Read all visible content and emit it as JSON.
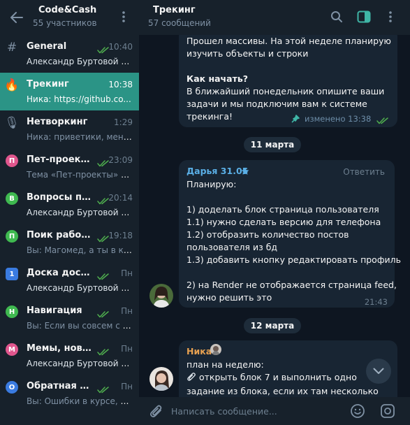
{
  "sidebar": {
    "title": "Code&Cash",
    "subtitle": "55 участников",
    "topics": [
      {
        "icon": "hash-icon",
        "icon_text": "#",
        "title": "General",
        "time": "10:40",
        "read": true,
        "sender": "Александр Буртовой о...",
        "preview": ""
      },
      {
        "icon": "fire-icon",
        "icon_text": "🔥",
        "title": "Трекинг",
        "time": "10:38",
        "read": false,
        "sender": "",
        "preview": "Ника: https://github.co...",
        "active": true
      },
      {
        "icon": "microphone-icon",
        "icon_text": "🎙",
        "title": "Нетворкинг",
        "time": "1:29",
        "read": false,
        "sender": "",
        "preview": "Ника: приветики, меня..."
      },
      {
        "icon": "letter-p-icon",
        "icon_text": "П",
        "color": "#e0568d",
        "title": "Пет-проекты",
        "time": "23:09",
        "read": true,
        "sender": "",
        "preview": "Тема «Пет-проекты» со..."
      },
      {
        "icon": "letter-v-icon",
        "icon_text": "В",
        "color": "#3fb950",
        "title": "Вопросы по ...",
        "time": "20:14",
        "read": true,
        "sender": "Александр Буртовой и...",
        "preview": ""
      },
      {
        "icon": "letter-p-icon",
        "icon_text": "П",
        "color": "#3fb950",
        "title": "Поик работ...",
        "time": "19:18",
        "read": true,
        "sender": "",
        "preview": "Вы: Магомед, а ты в ка..."
      },
      {
        "icon": "number-one-icon",
        "icon_text": "1",
        "color": "#3a7be0",
        "square": true,
        "title": "Доска достиже...",
        "time": "Пн",
        "read": true,
        "sender": "Александр Буртовой и...",
        "preview": ""
      },
      {
        "icon": "letter-n-icon",
        "icon_text": "Н",
        "color": "#3fb950",
        "title": "Навигация",
        "time": "Пн",
        "read": true,
        "sender": "",
        "preview": "Вы: Если вы совсем с 0 ..."
      },
      {
        "icon": "letter-m-icon",
        "icon_text": "М",
        "color": "#e0568d",
        "title": "Мемы, новост...",
        "time": "Пн",
        "read": true,
        "sender": "Александр Буртовой и...",
        "preview": ""
      },
      {
        "icon": "letter-o-icon",
        "icon_text": "О",
        "color": "#3a7be0",
        "title": "Обратная связ...",
        "time": "Пн",
        "read": true,
        "sender": "",
        "preview": "Вы: Ошибки в курсе, п..."
      }
    ]
  },
  "chat": {
    "title": "Трекинг",
    "subtitle": "57 сообщений",
    "messages": [
      {
        "lines": [
          "Прошел массивы. На этой неделе планирую",
          "изучить объекты и строки",
          "",
          "Как начать?",
          "В ближайший понедельник опишите ваши",
          "задачи и мы подключим вам к системе",
          "трекинга!"
        ],
        "bold_line": "Как начать?",
        "status": "изменено 13:38"
      },
      {
        "date": "11 марта"
      },
      {
        "author": "Дарья 31.05",
        "reply_label": "Ответить",
        "lines": [
          "Планирую:",
          "",
          "1) доделать блок страница пользователя",
          "1.1) нужно сделать версию для телефона",
          "1.2) отобразить количество постов",
          "пользователя из бд",
          "1.3) добавить кнопку редактировать профиль",
          "",
          "2) на Render не отображается страница feed,",
          "нужно решить это"
        ],
        "time": "21:43"
      },
      {
        "date": "12 марта"
      },
      {
        "author": "Ника",
        "lines": [
          "план на неделю:",
          "открыть блок 7 и выполнить одно",
          "задание из блока, если их там несколько"
        ]
      }
    ]
  },
  "input": {
    "placeholder": "Написать сообщение..."
  },
  "colors": {
    "accent": "#2b9486",
    "author_blue": "#5aafe6",
    "author_orange": "#e7a151",
    "check_green": "#4fae4e"
  }
}
